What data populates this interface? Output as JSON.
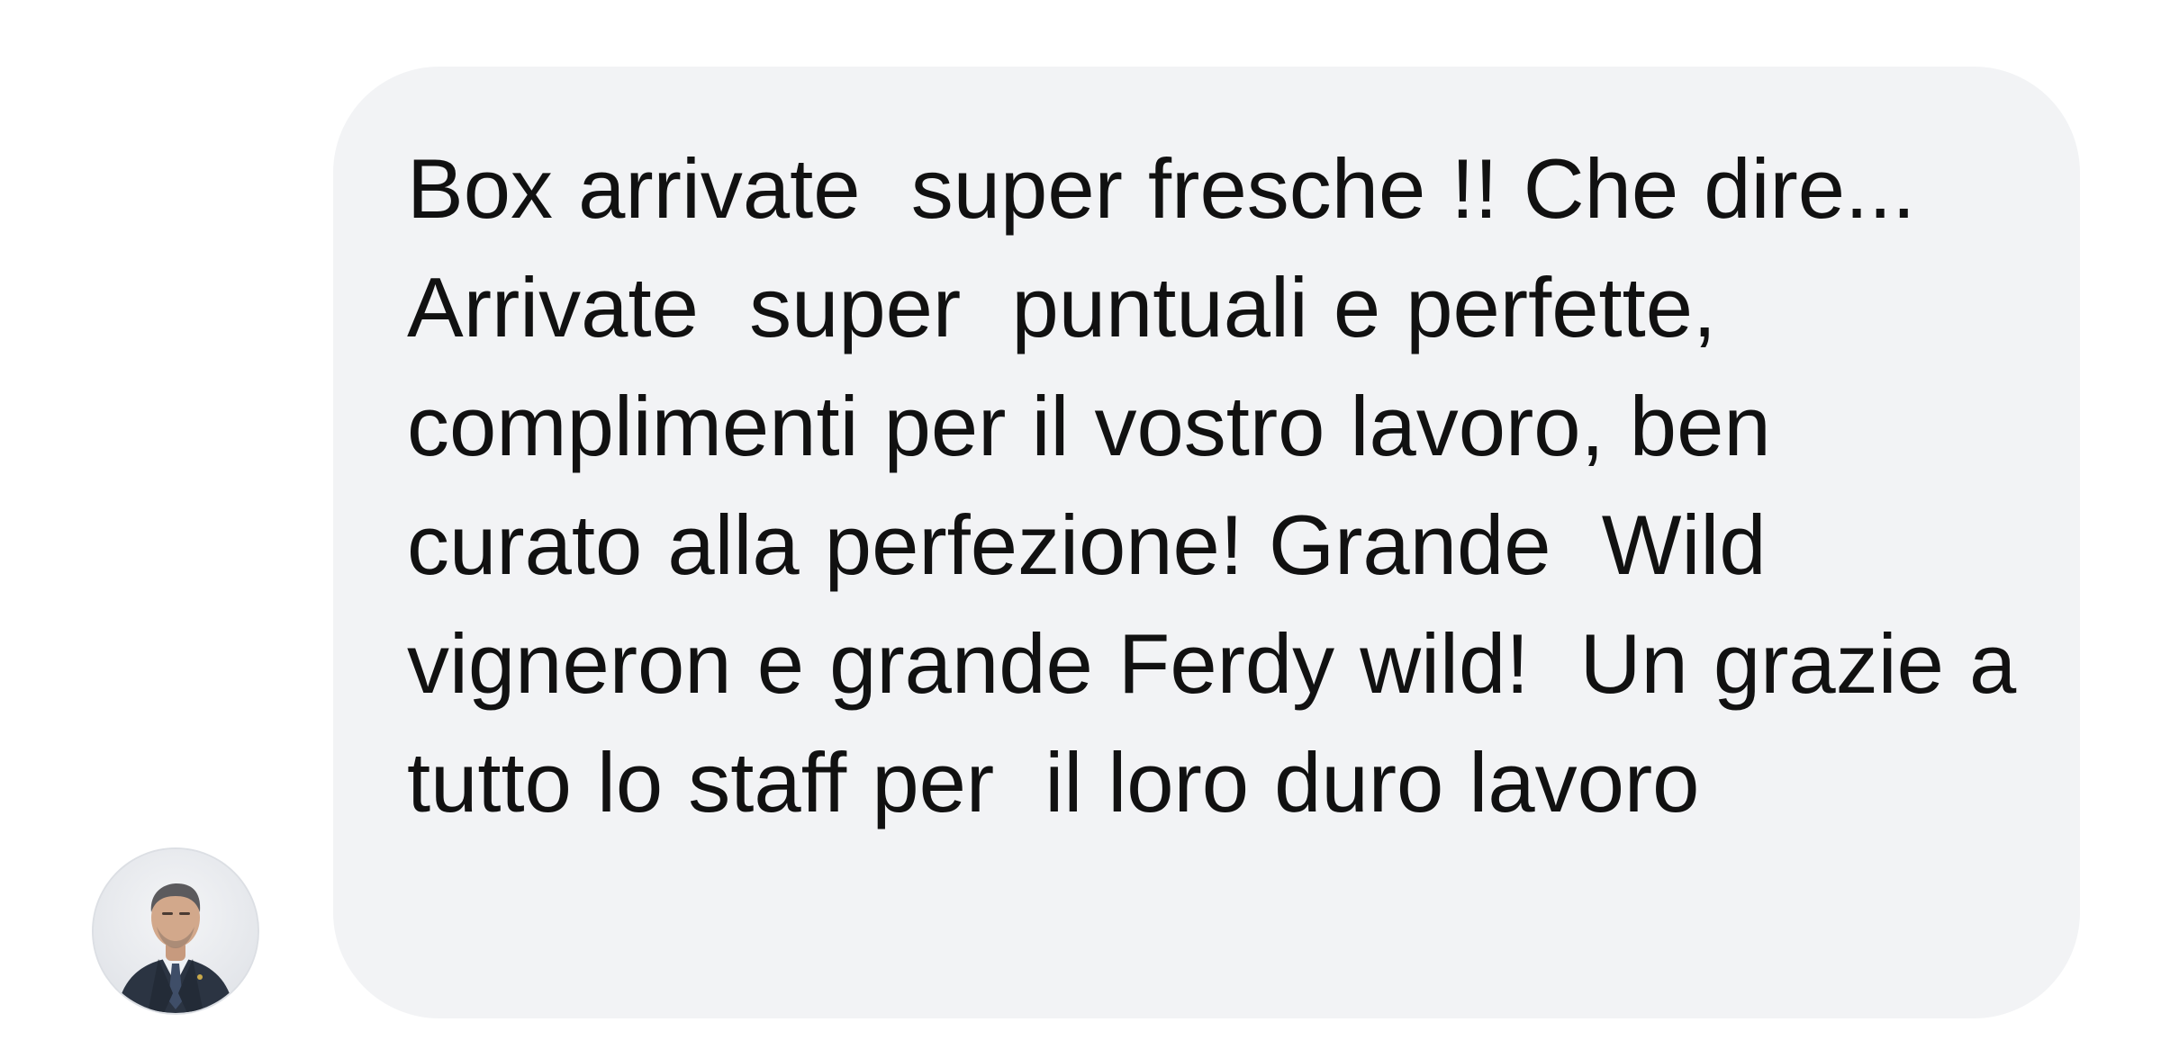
{
  "message": {
    "text": "Box arrivate  super fresche !! Che dire... Arrivate  super  puntuali e perfette, complimenti per il vostro lavoro, ben curato alla perfezione! Grande  Wild vigneron e grande Ferdy wild!  Un grazie a tutto lo staff per  il loro duro lavoro"
  },
  "sender": {
    "avatar_icon": "profile-photo-avatar"
  },
  "colors": {
    "bubble_background": "#f2f3f5",
    "text": "#111111",
    "page_background": "#ffffff"
  }
}
